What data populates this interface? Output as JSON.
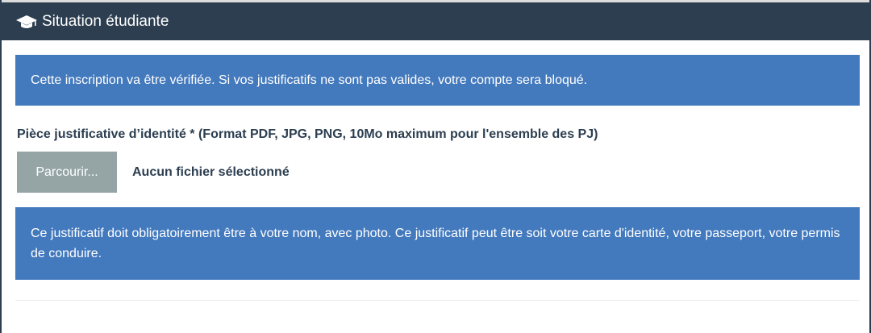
{
  "header": {
    "icon": "graduation-cap-icon",
    "title": "Situation étudiante"
  },
  "alerts": {
    "verification": "Cette inscription va être vérifiée. Si vos justificatifs ne sont pas valides, votre compte sera bloqué.",
    "id_requirements": "Ce justificatif doit obligatoirement être à votre nom, avec photo. Ce justificatif peut être soit votre carte d'identité, votre passeport, votre permis de conduire."
  },
  "upload": {
    "label": "Pièce justificative d’identité * (Format PDF, JPG, PNG, 10Mo maximum pour l'ensemble des PJ)",
    "browse_label": "Parcourir...",
    "status": "Aucun fichier sélectionné"
  },
  "colors": {
    "header_bg": "#2c3e50",
    "alert_bg": "#4379bd",
    "button_bg": "#95a5a6"
  }
}
